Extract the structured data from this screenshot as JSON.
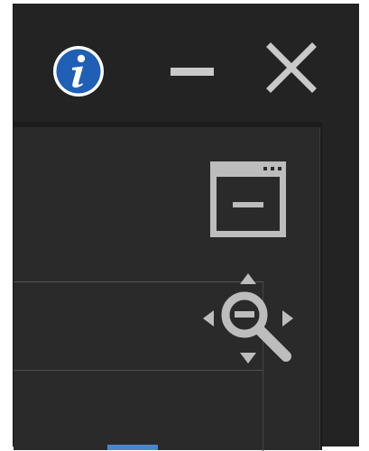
{
  "titlebar": {
    "info_icon": "info-icon",
    "minimize_icon": "minimize-icon",
    "close_icon": "close-icon"
  },
  "toolbar": {
    "window_tool_icon": "minimize-window-icon",
    "zoom_tool_icon": "zoom-move-icon"
  },
  "colors": {
    "background": "#232323",
    "panel": "#2a2a2a",
    "icon": "#bdbdbd",
    "info_blue": "#1f5fb5",
    "accent": "#4a86c8"
  }
}
